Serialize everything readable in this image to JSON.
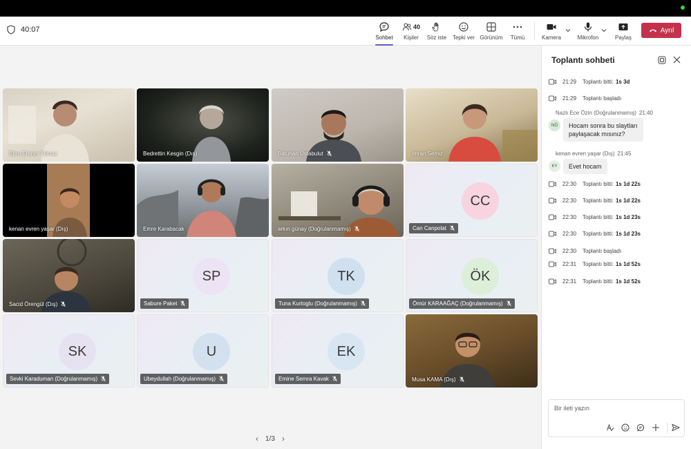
{
  "meeting": {
    "elapsed": "40:07"
  },
  "toolbar": {
    "chat_label": "Sohbet",
    "people_label": "Kişiler",
    "people_count": "40",
    "raise_label": "Söz iste",
    "react_label": "Tepki ver",
    "view_label": "Görünüm",
    "more_label": "Tümü",
    "camera_label": "Kamera",
    "mic_label": "Mikrofon",
    "share_label": "Paylaş",
    "leave_label": "Ayrıl"
  },
  "participants": [
    {
      "name": "Ebru Erener Yılmaz",
      "muted": false,
      "type": "video"
    },
    {
      "name": "Bedrettin Kesgin (Dış)",
      "muted": false,
      "type": "video"
    },
    {
      "name": "Batuhan Ustabulut",
      "muted": true,
      "type": "video"
    },
    {
      "name": "İmran Semiz",
      "muted": false,
      "type": "video"
    },
    {
      "name": "kenan evren yaşar (Dış)",
      "muted": false,
      "type": "video"
    },
    {
      "name": "Emre Karabacak",
      "muted": false,
      "type": "video"
    },
    {
      "name": "arkın günay (Doğrulanmamış)",
      "muted": true,
      "type": "video"
    },
    {
      "name": "Can Canpolat",
      "muted": true,
      "type": "avatar",
      "initials": "CC",
      "color": "#f7d4df"
    },
    {
      "name": "Sacid Örengül (Dış)",
      "muted": true,
      "type": "video"
    },
    {
      "name": "Sabure Paket",
      "muted": true,
      "type": "avatar",
      "initials": "SP",
      "color": "#ece4f4"
    },
    {
      "name": "Tuna Kurtoglu (Doğrulanmamış)",
      "muted": true,
      "type": "avatar",
      "initials": "TK",
      "color": "#cfe0ef"
    },
    {
      "name": "Ömür KARAAĞAÇ (Doğrulanmamış)",
      "muted": true,
      "type": "avatar",
      "initials": "ÖK",
      "color": "#dcefd9"
    },
    {
      "name": "Sevki Karaduman (Doğrulanmamış)",
      "muted": true,
      "type": "avatar",
      "initials": "SK",
      "color": "#e7e2f1"
    },
    {
      "name": "Ubeydullah (Doğrulanmamış)",
      "muted": true,
      "type": "avatar",
      "initials": "U",
      "color": "#d3e1ef"
    },
    {
      "name": "Emine Semra Kavak",
      "muted": true,
      "type": "avatar",
      "initials": "EK",
      "color": "#d7e6f0"
    },
    {
      "name": "Musa KAMA (Dış)",
      "muted": true,
      "type": "video"
    }
  ],
  "pager": {
    "label": "1/3"
  },
  "chat": {
    "title": "Toplantı sohbeti",
    "items": [
      {
        "kind": "sys",
        "time": "21:29",
        "text": "Toplantı bitti:",
        "bold": "1s 3d"
      },
      {
        "kind": "sys",
        "time": "21:29",
        "text": "Toplantı başladı",
        "bold": ""
      },
      {
        "kind": "msg",
        "author": "Nazlı Ece Özin (Doğrulanmamış)",
        "time": "21:40",
        "initials": "NÖ",
        "lines": [
          "Hocam sonra bu slaytları",
          "paylaşacak mısınız?"
        ]
      },
      {
        "kind": "msg",
        "author": "kenan evren yaşar (Dış)",
        "time": "21:45",
        "initials": "KY",
        "lines": [
          "Evet hocam"
        ]
      },
      {
        "kind": "sys",
        "time": "22:30",
        "text": "Toplantı bitti:",
        "bold": "1s 1d 22s"
      },
      {
        "kind": "sys",
        "time": "22:30",
        "text": "Toplantı bitti:",
        "bold": "1s 1d 22s"
      },
      {
        "kind": "sys",
        "time": "22:30",
        "text": "Toplantı bitti:",
        "bold": "1s 1d 23s"
      },
      {
        "kind": "sys",
        "time": "22:30",
        "text": "Toplantı bitti:",
        "bold": "1s 1d 23s"
      },
      {
        "kind": "sys",
        "time": "22:30",
        "text": "Toplantı başladı",
        "bold": ""
      },
      {
        "kind": "sys",
        "time": "22:31",
        "text": "Toplantı bitti:",
        "bold": "1s 1d 52s"
      },
      {
        "kind": "sys",
        "time": "22:31",
        "text": "Toplantı bitti:",
        "bold": "1s 1d 52s"
      }
    ],
    "composer_placeholder": "Bir ileti yazın"
  }
}
